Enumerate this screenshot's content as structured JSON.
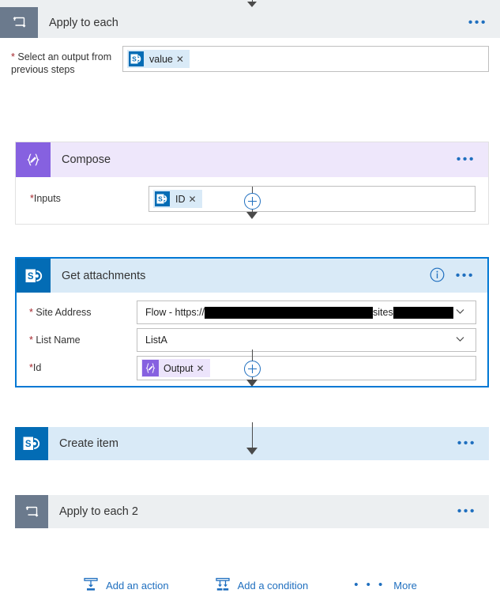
{
  "scope": {
    "title": "Apply to each",
    "icon": "loop-icon",
    "menu": "•••",
    "field": {
      "label": "Select an output from previous steps",
      "required": true,
      "token": {
        "text": "value",
        "icon": "sharepoint-icon",
        "remove": "✕"
      }
    }
  },
  "compose": {
    "title": "Compose",
    "icon": "compose-icon",
    "menu": "•••",
    "field": {
      "label": "Inputs",
      "required": true,
      "token": {
        "text": "ID",
        "icon": "sharepoint-icon",
        "remove": "✕"
      }
    }
  },
  "get_attachments": {
    "title": "Get attachments",
    "icon": "sharepoint-icon",
    "info": "i",
    "menu": "•••",
    "selected": true,
    "fields": {
      "site_address": {
        "label": "Site Address",
        "required": true,
        "prefix": "Flow - https://",
        "middle": "sites",
        "redacted_1_width": 213,
        "redacted_2_width": 76,
        "chevron": "chevron-down-icon"
      },
      "list_name": {
        "label": "List Name",
        "required": true,
        "value": "ListA",
        "chevron": "chevron-down-icon"
      },
      "id": {
        "label": "Id",
        "required": true,
        "token": {
          "text": "Output",
          "icon": "compose-icon",
          "remove": "✕"
        }
      }
    }
  },
  "create_item": {
    "title": "Create item",
    "icon": "sharepoint-icon",
    "menu": "•••"
  },
  "apply_to_each_2": {
    "title": "Apply to each 2",
    "icon": "loop-icon",
    "menu": "•••"
  },
  "add_bar": {
    "add_action": "Add an action",
    "add_condition": "Add a condition",
    "more_dots": "• • •",
    "more": "More"
  },
  "colors": {
    "accent_blue": "#1f6fbf",
    "sharepoint_blue": "#036cb5",
    "compose_purple": "#8661e0",
    "scope_gray": "#6b7a8d",
    "selected_border": "#0078d4",
    "required_red": "#a4262c",
    "token_blue_bg": "#d9eaf7",
    "token_purple_bg": "#ece4fb"
  }
}
